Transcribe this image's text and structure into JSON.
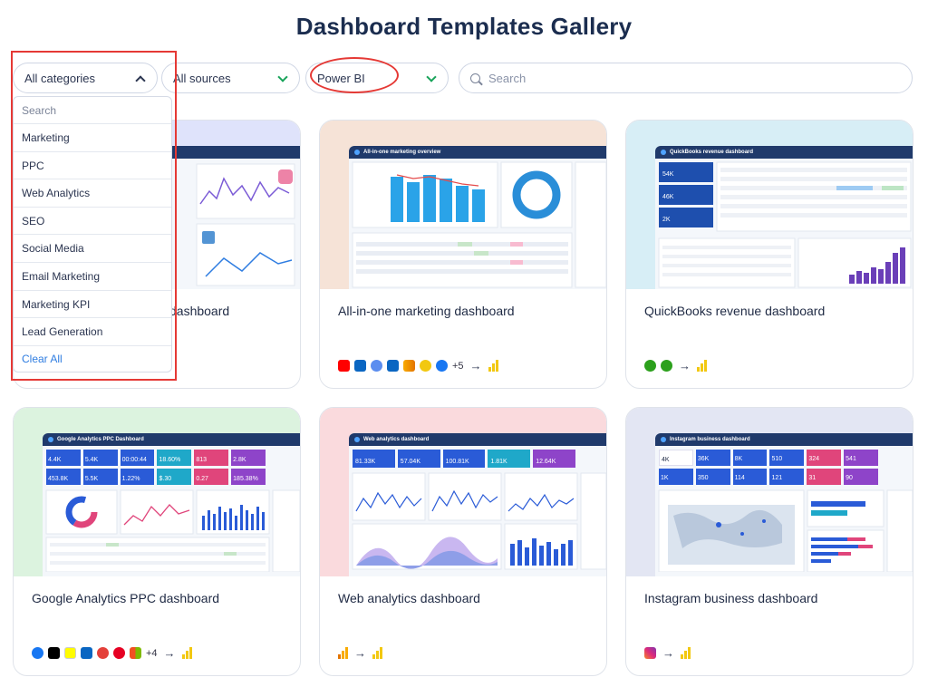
{
  "page": {
    "title": "Dashboard Templates Gallery"
  },
  "filters": {
    "category": "All categories",
    "sources": "All sources",
    "tool": "Power BI",
    "search_placeholder": "Search"
  },
  "dropdown": {
    "search": "Search",
    "items": [
      "Marketing",
      "PPC",
      "Web Analytics",
      "SEO",
      "Social Media",
      "Email Marketing",
      "Marketing KPI",
      "Lead Generation"
    ],
    "clear": "Clear All"
  },
  "cards": [
    {
      "name": "dashboard",
      "hero_color": "#dfe3fb",
      "more": ""
    },
    {
      "name": "All-in-one marketing dashboard",
      "hero_color": "#f6e3d7",
      "more": "+5"
    },
    {
      "name": "QuickBooks revenue dashboard",
      "hero_color": "#d7eef6",
      "more": ""
    },
    {
      "name": "Google Analytics PPC dashboard",
      "hero_color": "#dcf3df",
      "more": "+4"
    },
    {
      "name": "Web analytics dashboard",
      "hero_color": "#fadadd",
      "more": ""
    },
    {
      "name": "Instagram business dashboard",
      "hero_color": "#e3e6f3",
      "more": ""
    }
  ],
  "preview_text": {
    "card2_title": "All-in-one marketing overview",
    "card3_title": "QuickBooks revenue dashboard",
    "card3_kpis": [
      "54K",
      "46K",
      "2K"
    ],
    "card4_title": "Google Analytics PPC Dashboard",
    "card4_kpis": [
      "4.4K",
      "5.4K",
      "00:00:44",
      "18.60%",
      "813",
      "2.8K",
      "453.8K",
      "5.5K",
      "1.22%",
      "$.30",
      "0.27",
      "185.38%"
    ],
    "card5_title": "Web analytics dashboard",
    "card5_kpis": [
      "81.33K",
      "57.04K",
      "100.81K",
      "1.81K",
      "12.64K"
    ],
    "card6_title": "Instagram business dashboard",
    "card6_kpis": [
      "4K",
      "36K",
      "8K",
      "510",
      "324",
      "541",
      "1K",
      "350",
      "114",
      "121",
      "31",
      "90"
    ]
  },
  "colors": {
    "accent_green": "#18a35a",
    "highlight_red": "#e53935",
    "pbi_yellow": "#f2c811",
    "link_blue": "#2f7de1"
  }
}
